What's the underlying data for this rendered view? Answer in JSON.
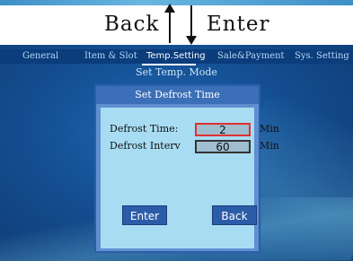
{
  "annotations": {
    "back_label": "Back",
    "enter_label": "Enter"
  },
  "tabs": [
    {
      "label": "General",
      "active": false
    },
    {
      "label": "Item & Slot",
      "active": false
    },
    {
      "label": "Temp.Setting",
      "active": true
    },
    {
      "label": "Sale&Payment",
      "active": false
    },
    {
      "label": "Sys. Setting",
      "active": false
    }
  ],
  "subtitle": "Set Temp. Mode",
  "dialog": {
    "title": "Set Defrost Time",
    "rows": [
      {
        "label": "Defrost Time:",
        "value": "2",
        "unit": "Min",
        "focused": true
      },
      {
        "label": "Defrost Interv",
        "value": "60",
        "unit": "Min",
        "focused": false
      }
    ],
    "enter_button": "Enter",
    "back_button": "Back"
  },
  "colors": {
    "screen_bg": "#144f92",
    "tab_bar": "#0b3c7c",
    "dialog_title": "#3b6fb7",
    "dialog_body": "#a8dcf2",
    "focus_border": "#e03030",
    "button": "#2b5ca8"
  }
}
